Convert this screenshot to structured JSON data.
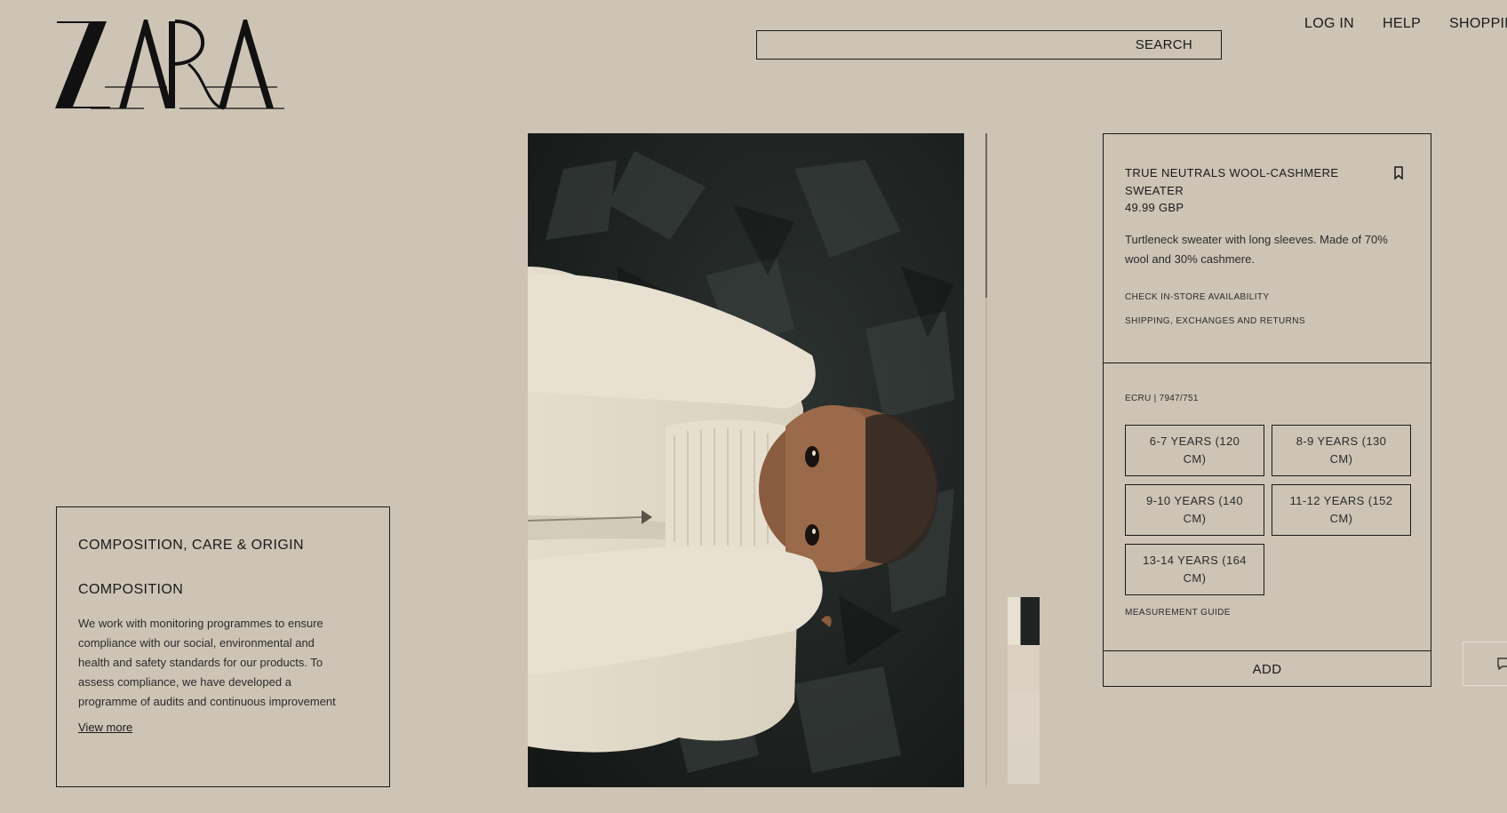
{
  "header": {
    "logo_text": "ZARA",
    "search_label": "SEARCH",
    "nav": [
      "LOG IN",
      "HELP",
      "SHOPPIN"
    ]
  },
  "composition": {
    "title": "COMPOSITION, CARE & ORIGIN",
    "subtitle": "COMPOSITION",
    "text": "We work with monitoring programmes to ensure compliance with our social, environmental and health and safety standards for our products. To assess compliance, we have developed a programme of audits and continuous improvement plans.",
    "view_more": "View more"
  },
  "product": {
    "title": "TRUE NEUTRALS WOOL-CASHMERE SWEATER",
    "price": "49.99 GBP",
    "description": "Turtleneck sweater with long sleeves. Made of 70% wool and 30% cashmere.",
    "check_store": "CHECK IN-STORE AVAILABILITY",
    "shipping": "SHIPPING, EXCHANGES AND RETURNS",
    "color_ref": "ECRU | 7947/751",
    "sizes": [
      "6-7 YEARS (120 CM)",
      "8-9 YEARS (130 CM)",
      "9-10 YEARS (140 CM)",
      "11-12 YEARS (152 CM)",
      "13-14 YEARS (164 CM)"
    ],
    "measurement_guide": "MEASUREMENT GUIDE",
    "add_label": "ADD"
  },
  "icons": {
    "bookmark": "bookmark-icon",
    "chat": "chat-icon"
  },
  "colors": {
    "background": "#cdc4b5",
    "text": "#1a1a1a"
  }
}
